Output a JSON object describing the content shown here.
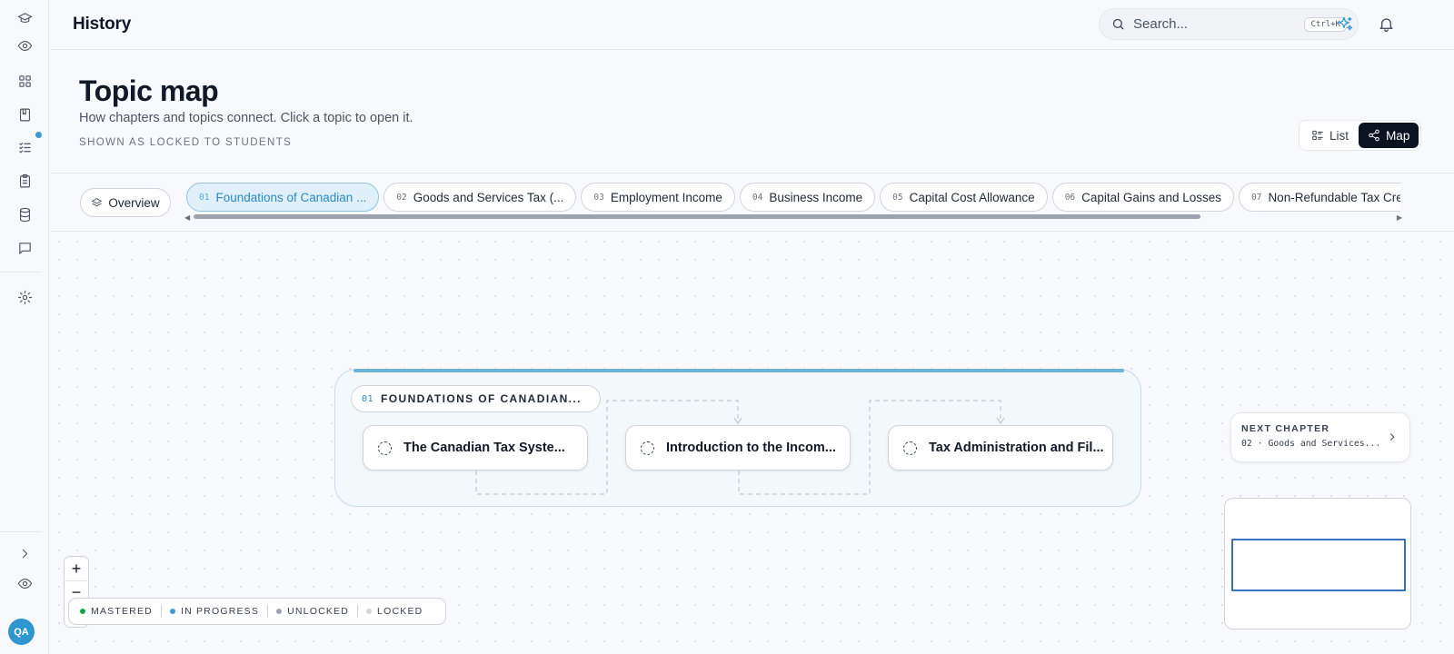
{
  "app": {
    "title": "History"
  },
  "search": {
    "placeholder": "Search...",
    "shortcut": "Ctrl+K"
  },
  "topbar_icons": [
    "sparkle-icon",
    "bell-icon"
  ],
  "sidebar": {
    "items": [
      "graduation-cap-icon",
      "eye-icon",
      "grid-icon",
      "book-icon",
      "checklist-icon",
      "clipboard-icon",
      "database-icon",
      "message-icon",
      "settings-icon"
    ],
    "bottom_items": [
      "chevron-right-icon",
      "eye-icon"
    ],
    "notification_color": "#3b9bd6",
    "avatar": {
      "initials": "QA",
      "color": "#2f96d0"
    }
  },
  "header": {
    "title": "Topic map",
    "subtitle": "How chapters and topics connect. Click a topic to open it.",
    "note": "SHOWN AS LOCKED TO STUDENTS",
    "view_toggle": {
      "list_label": "List",
      "map_label": "Map",
      "selected": "Map"
    }
  },
  "chapter_strip": {
    "overview_label": "Overview",
    "chips": [
      {
        "num": "01",
        "label": "Foundations of Canadian ...",
        "active": true
      },
      {
        "num": "02",
        "label": "Goods and Services Tax (...",
        "active": false
      },
      {
        "num": "03",
        "label": "Employment Income",
        "active": false
      },
      {
        "num": "04",
        "label": "Business Income",
        "active": false
      },
      {
        "num": "05",
        "label": "Capital Cost Allowance",
        "active": false
      },
      {
        "num": "06",
        "label": "Capital Gains and Losses",
        "active": false
      },
      {
        "num": "07",
        "label": "Non-Refundable Tax Cred",
        "active": false
      }
    ]
  },
  "map": {
    "group": {
      "num": "01",
      "title": "FOUNDATIONS OF CANADIAN...",
      "accent_color": "#6fb3d8",
      "topics": [
        {
          "label": "The Canadian Tax Syste..."
        },
        {
          "label": "Introduction to the Incom..."
        },
        {
          "label": "Tax Administration and Fil..."
        }
      ]
    },
    "next_chapter": {
      "label": "NEXT CHAPTER",
      "value": "02 · Goods and Services..."
    },
    "zoom": {
      "in_label": "+",
      "out_label": "−"
    },
    "legend": [
      {
        "label": "MASTERED",
        "color": "#16a34a"
      },
      {
        "label": "IN PROGRESS",
        "color": "#3b9bd6"
      },
      {
        "label": "UNLOCKED",
        "color": "#9ca3af"
      },
      {
        "label": "LOCKED",
        "color": "#d1d5db"
      }
    ]
  },
  "colors": {
    "accent": "#2b89c5",
    "sparkle": "#2f9bd6",
    "minimap_viewport": "#3b6fc0"
  }
}
